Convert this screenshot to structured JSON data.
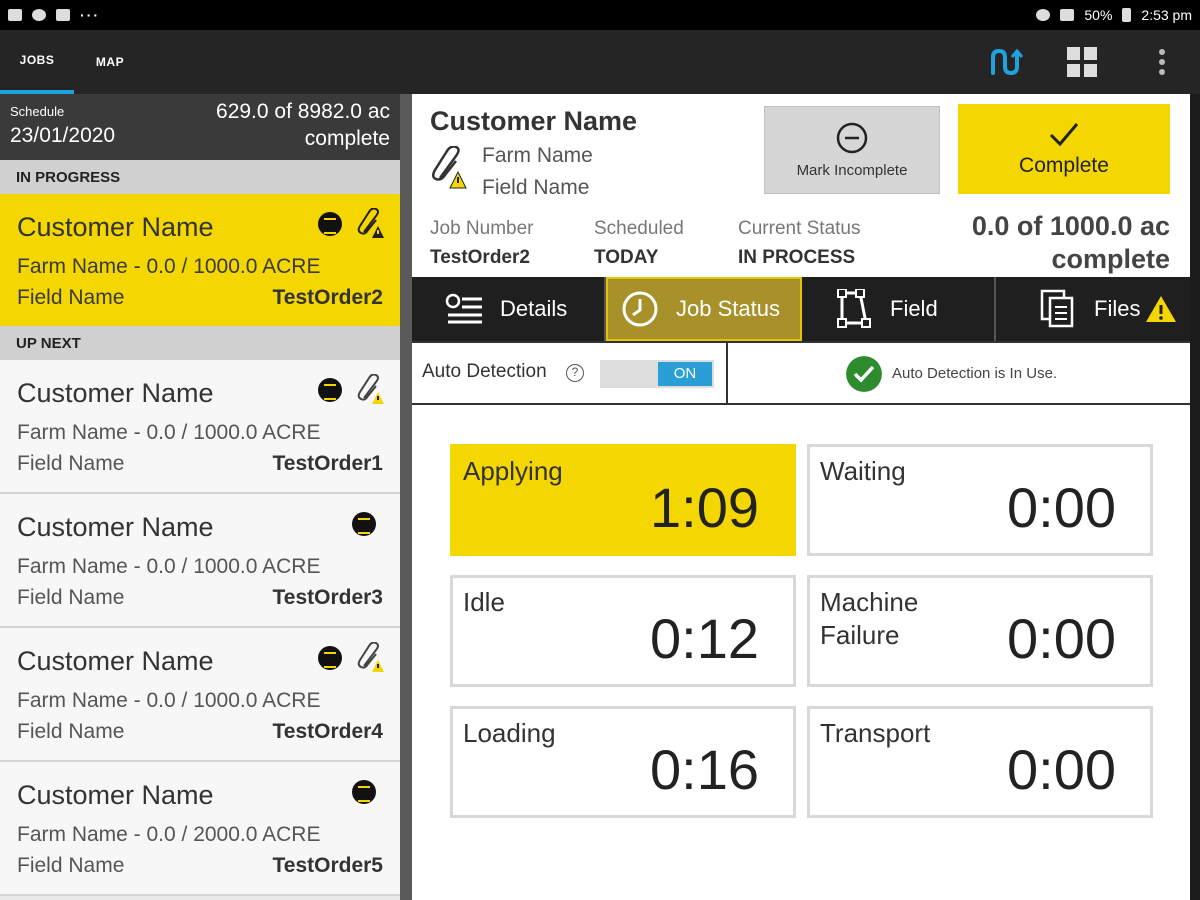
{
  "status_bar": {
    "battery": "50%",
    "time": "2:53 pm",
    "overflow": "···"
  },
  "top_tabs": [
    {
      "label": "JOBS"
    },
    {
      "label": "MAP"
    }
  ],
  "schedule": {
    "label": "Schedule",
    "date": "23/01/2020",
    "progress_line1": "629.0 of 8982.0 ac",
    "progress_line2": "complete"
  },
  "sections": {
    "in_progress": "IN PROGRESS",
    "up_next": "UP NEXT"
  },
  "jobs": [
    {
      "customer": "Customer Name",
      "farm": "Farm Name - 0.0 / 1000.0 ACRE",
      "field": "Field Name",
      "order": "TestOrder2",
      "attachment_warning": true
    },
    {
      "customer": "Customer Name",
      "farm": "Farm Name - 0.0 / 1000.0 ACRE",
      "field": "Field Name",
      "order": "TestOrder1",
      "attachment_warning": true
    },
    {
      "customer": "Customer Name",
      "farm": "Farm Name - 0.0 / 1000.0 ACRE",
      "field": "Field Name",
      "order": "TestOrder3",
      "attachment_warning": false
    },
    {
      "customer": "Customer Name",
      "farm": "Farm Name - 0.0 / 1000.0 ACRE",
      "field": "Field Name",
      "order": "TestOrder4",
      "attachment_warning": true
    },
    {
      "customer": "Customer Name",
      "farm": "Farm Name - 0.0 / 2000.0 ACRE",
      "field": "Field Name",
      "order": "TestOrder5",
      "attachment_warning": false
    }
  ],
  "detail": {
    "customer": "Customer Name",
    "farm": "Farm Name",
    "field": "Field Name",
    "mark_incomplete_label": "Mark Incomplete",
    "complete_label": "Complete",
    "job_number_label": "Job Number",
    "job_number": "TestOrder2",
    "scheduled_label": "Scheduled",
    "scheduled": "TODAY",
    "status_label": "Current Status",
    "status": "IN PROCESS",
    "progress_line1": "0.0 of 1000.0 ac",
    "progress_line2": "complete"
  },
  "detail_tabs": [
    {
      "label": "Details"
    },
    {
      "label": "Job Status"
    },
    {
      "label": "Field"
    },
    {
      "label": "Files"
    }
  ],
  "auto_detection": {
    "label": "Auto Detection",
    "help": "?",
    "toggle": "ON",
    "status": "Auto Detection is In Use."
  },
  "timers": [
    {
      "label": "Applying",
      "value": "1:09"
    },
    {
      "label": "Waiting",
      "value": "0:00"
    },
    {
      "label": "Idle",
      "value": "0:12"
    },
    {
      "label": "Machine Failure",
      "value": "0:00"
    },
    {
      "label": "Loading",
      "value": "0:16"
    },
    {
      "label": "Transport",
      "value": "0:00"
    }
  ],
  "colors": {
    "accent_yellow": "#f4d600",
    "accent_blue": "#1fa3e0",
    "success_green": "#2e8b2e"
  }
}
